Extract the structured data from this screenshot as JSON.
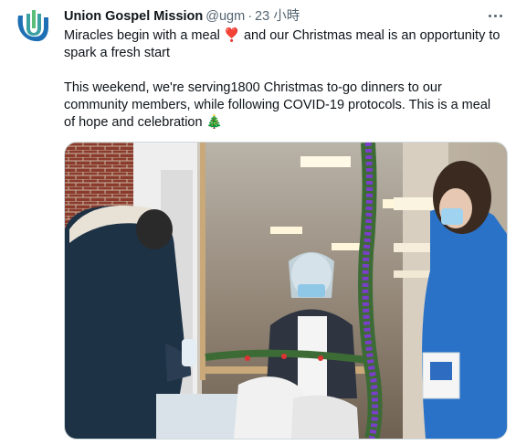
{
  "tweet": {
    "display_name": "Union Gospel Mission",
    "handle": "@ugm",
    "separator": "·",
    "time": "23 小時",
    "line1_part1": "Miracles begin with a meal",
    "line1_emoji": "❣️",
    "line1_part2": "and our Christmas meal is an opportunity to spark a fresh start",
    "line2_text": "This weekend, we're serving1800 Christmas to-go dinners to our community members, while following COVID-19 protocols. This is a meal of hope and celebration",
    "line2_emoji": "🎄"
  },
  "icons": {
    "avatar": "union-gospel-mission-logo",
    "more": "more-options-icon"
  },
  "colors": {
    "text": "#0f1419",
    "secondary": "#536471",
    "logo_blue": "#1f6fb5",
    "logo_green": "#3aa0a0"
  }
}
